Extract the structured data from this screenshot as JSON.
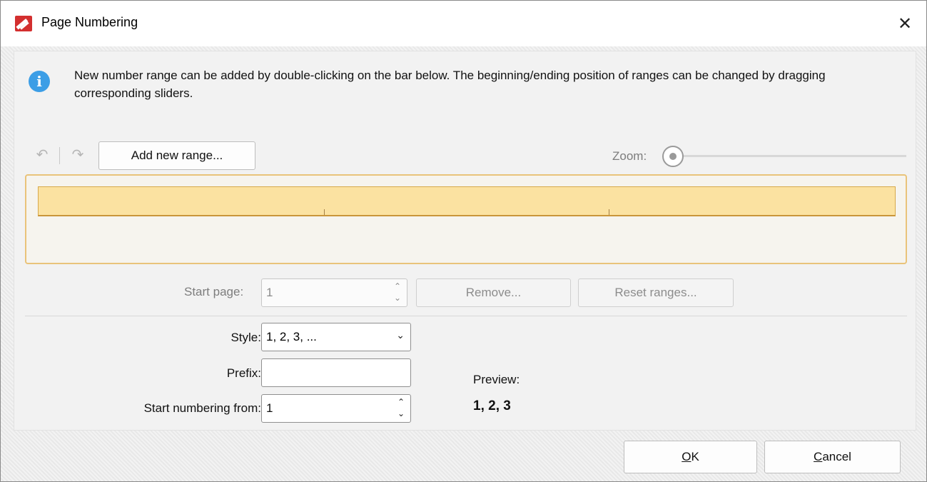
{
  "window": {
    "title": "Page Numbering",
    "close_glyph": "✕"
  },
  "info": {
    "icon": "info-icon",
    "text": "New number range can be added by double-clicking on the bar below. The beginning/ending position of ranges can be changed by dragging corresponding sliders."
  },
  "toolbar": {
    "undo_icon": "undo-icon",
    "redo_icon": "redo-icon",
    "add_range_label": "Add new range...",
    "zoom_label": "Zoom:",
    "zoom_level": 0
  },
  "range": {
    "start_page_label": "Start page:",
    "start_page_value": "1",
    "remove_label": "Remove...",
    "reset_label": "Reset ranges..."
  },
  "format": {
    "style_label": "Style:",
    "style_value": "1, 2, 3, ...",
    "prefix_label": "Prefix:",
    "prefix_value": "",
    "start_numbering_label": "Start numbering from:",
    "start_numbering_value": "1",
    "preview_label": "Preview:",
    "preview_value": "1, 2, 3"
  },
  "footer": {
    "ok_label": "OK",
    "ok_mnemonic": "O",
    "ok_rest": "K",
    "cancel_label": "Cancel",
    "cancel_mnemonic": "C",
    "cancel_rest": "ancel"
  },
  "colors": {
    "accent": "#3c9ee6",
    "range_bar": "#fbe2a1",
    "range_border": "#e9c37a",
    "app_icon": "#d32f2f"
  }
}
